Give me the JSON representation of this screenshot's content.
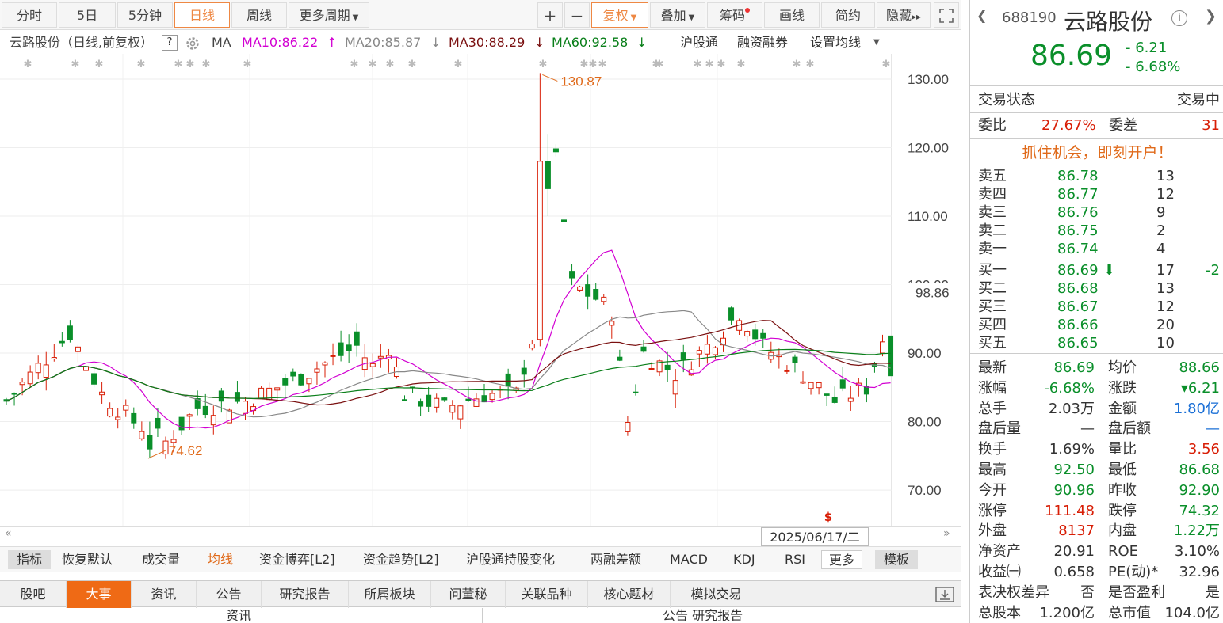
{
  "toolbar": {
    "periods": [
      "分时",
      "5日",
      "5分钟",
      "日线",
      "周线",
      "更多周期"
    ],
    "active_period": "日线",
    "tools": [
      "复权",
      "叠加",
      "筹码",
      "画线",
      "简约",
      "隐藏"
    ],
    "plus": "+",
    "minus": "−"
  },
  "ma": {
    "title": "云路股份（日线,前复权）",
    "help": "?",
    "label": "MA",
    "ma10": "MA10:86.22",
    "ma20": "MA20:85.87",
    "ma30": "MA30:88.29",
    "ma60": "MA60:92.58",
    "hgt": "沪股通",
    "margin": "融资融券",
    "setting": "设置均线"
  },
  "chart_data": {
    "type": "candlestick",
    "yticks": [
      "130.00",
      "120.00",
      "110.00",
      "100.00",
      "90.00",
      "80.00",
      "70.00"
    ],
    "ylim": [
      65.5,
      133
    ],
    "current_price_label": "98.86",
    "high_label": "130.87",
    "low_label": "74.62",
    "date_label": "2025/06/17/二",
    "colors": {
      "up": "#d81e06",
      "down": "#0a8f2a",
      "ma10": "#d200d2",
      "ma20": "#888888",
      "ma30": "#7a1010",
      "ma60": "#0a7f1a"
    }
  },
  "indicators": [
    "指标",
    "恢复默认",
    "成交量",
    "均线",
    "资金博弈[L2]",
    "资金趋势[L2]",
    "沪股通持股变化",
    "两融差额",
    "MACD",
    "KDJ",
    "RSI",
    "更多",
    "模板"
  ],
  "tabs": [
    "股吧",
    "大事",
    "资讯",
    "公告",
    "研究报告",
    "所属板块",
    "问董秘",
    "关联品种",
    "核心题材",
    "模拟交易"
  ],
  "active_tab": "大事",
  "low": {
    "left": "资讯",
    "right": "公告  研究报告"
  },
  "quote": {
    "code": "688190",
    "name": "云路股份",
    "price": "86.69",
    "change": "- 6.21",
    "pct": "- 6.68%",
    "status_label": "交易状态",
    "status_value": "交易中",
    "wb_label": "委比",
    "wb_value": "27.67%",
    "wc_label": "委差",
    "wc_value": "31",
    "promo": "抓住机会，即刻开户！",
    "asks": [
      {
        "label": "卖五",
        "price": "86.78",
        "vol": "13"
      },
      {
        "label": "卖四",
        "price": "86.77",
        "vol": "12"
      },
      {
        "label": "卖三",
        "price": "86.76",
        "vol": "9"
      },
      {
        "label": "卖二",
        "price": "86.75",
        "vol": "2"
      },
      {
        "label": "卖一",
        "price": "86.74",
        "vol": "4"
      }
    ],
    "bids": [
      {
        "label": "买一",
        "price": "86.69",
        "vol": "17",
        "chg": "-2"
      },
      {
        "label": "买二",
        "price": "86.68",
        "vol": "13",
        "chg": ""
      },
      {
        "label": "买三",
        "price": "86.67",
        "vol": "12",
        "chg": ""
      },
      {
        "label": "买四",
        "price": "86.66",
        "vol": "20",
        "chg": ""
      },
      {
        "label": "买五",
        "price": "86.65",
        "vol": "10",
        "chg": ""
      }
    ],
    "stats": [
      [
        "最新",
        "86.69",
        "均价",
        "88.66"
      ],
      [
        "涨幅",
        "-6.68%",
        "涨跌",
        "▾6.21"
      ],
      [
        "总手",
        "2.03万",
        "金额",
        "1.80亿"
      ],
      [
        "盘后量",
        "—",
        "盘后额",
        "—"
      ],
      [
        "换手",
        "1.69%",
        "量比",
        "3.56"
      ],
      [
        "最高",
        "92.50",
        "最低",
        "86.68"
      ],
      [
        "今开",
        "90.96",
        "昨收",
        "92.90"
      ],
      [
        "涨停",
        "111.48",
        "跌停",
        "74.32"
      ],
      [
        "外盘",
        "8137",
        "内盘",
        "1.22万"
      ],
      [
        "净资产",
        "20.91",
        "ROE",
        "3.10%"
      ],
      [
        "收益㈠",
        "0.658",
        "PE(动)*",
        "32.96"
      ],
      [
        "表决权差异",
        "否",
        "是否盈利",
        "是"
      ],
      [
        "总股本",
        "1.200亿",
        "总市值",
        "104.0亿"
      ]
    ]
  }
}
